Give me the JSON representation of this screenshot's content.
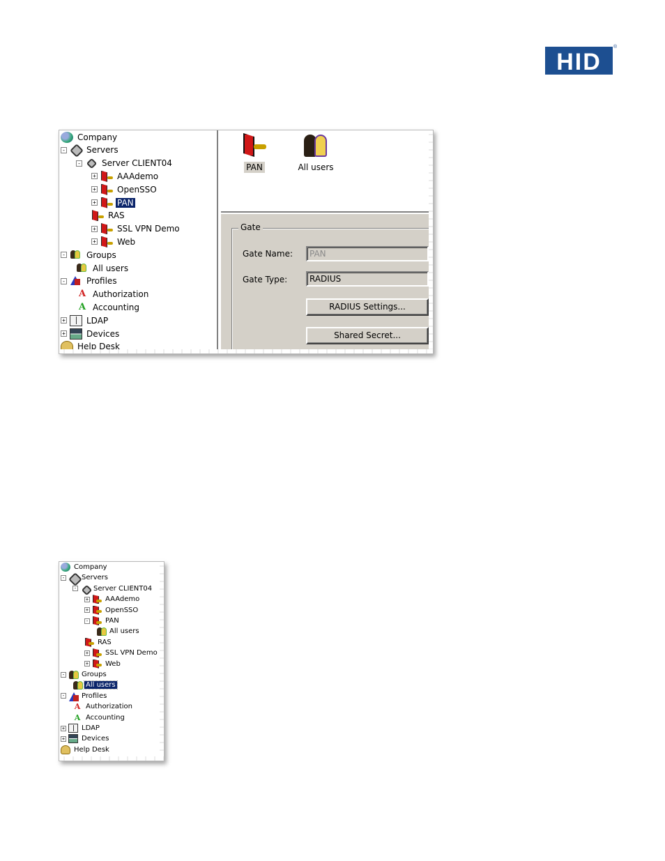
{
  "logo": {
    "text": "HID",
    "mark": "®"
  },
  "screenshot1": {
    "tree": [
      {
        "label": "Company",
        "icon": "globe-icon"
      },
      {
        "label": "Servers",
        "icon": "servers-icon",
        "expander": "-"
      },
      {
        "label": "Server CLIENT04",
        "icon": "server-icon",
        "expander": "-"
      },
      {
        "label": "AAAdemo",
        "icon": "gate-icon",
        "expander": "+"
      },
      {
        "label": "OpenSSO",
        "icon": "gate-icon",
        "expander": "+"
      },
      {
        "label": "PAN",
        "icon": "gate-icon",
        "expander": "+",
        "selected": true
      },
      {
        "label": "RAS",
        "icon": "gate-icon"
      },
      {
        "label": "SSL VPN Demo",
        "icon": "gate-icon",
        "expander": "+"
      },
      {
        "label": "Web",
        "icon": "gate-icon",
        "expander": "+"
      },
      {
        "label": "Groups",
        "icon": "users-icon",
        "expander": "-"
      },
      {
        "label": "All users",
        "icon": "users-icon"
      },
      {
        "label": "Profiles",
        "icon": "profiles-icon",
        "expander": "-"
      },
      {
        "label": "Authorization",
        "icon": "authorization-icon"
      },
      {
        "label": "Accounting",
        "icon": "accounting-icon"
      },
      {
        "label": "LDAP",
        "icon": "ldap-icon",
        "expander": "+"
      },
      {
        "label": "Devices",
        "icon": "devices-icon",
        "expander": "+"
      },
      {
        "label": "Help Desk",
        "icon": "help-desk-icon"
      }
    ],
    "list_items": [
      {
        "label": "PAN",
        "icon": "gate-icon"
      },
      {
        "label": "All users",
        "icon": "users-icon"
      }
    ],
    "gate": {
      "group_title": "Gate",
      "name_label": "Gate Name:",
      "name_value": "PAN",
      "type_label": "Gate Type:",
      "type_value": "RADIUS",
      "radius_settings_button": "RADIUS Settings...",
      "shared_secret_button": "Shared Secret..."
    }
  },
  "screenshot2": {
    "tree": [
      {
        "label": "Company",
        "icon": "globe-icon"
      },
      {
        "label": "Servers",
        "icon": "servers-icon",
        "expander": "-"
      },
      {
        "label": "Server CLIENT04",
        "icon": "server-icon",
        "expander": "-"
      },
      {
        "label": "AAAdemo",
        "icon": "gate-icon",
        "expander": "+"
      },
      {
        "label": "OpenSSO",
        "icon": "gate-icon",
        "expander": "+"
      },
      {
        "label": "PAN",
        "icon": "gate-icon",
        "expander": "-"
      },
      {
        "label": "All users",
        "icon": "users-icon"
      },
      {
        "label": "RAS",
        "icon": "gate-icon"
      },
      {
        "label": "SSL VPN Demo",
        "icon": "gate-icon",
        "expander": "+"
      },
      {
        "label": "Web",
        "icon": "gate-icon",
        "expander": "+"
      },
      {
        "label": "Groups",
        "icon": "users-icon",
        "expander": "-"
      },
      {
        "label": "All users",
        "icon": "users-icon",
        "selected": true
      },
      {
        "label": "Profiles",
        "icon": "profiles-icon",
        "expander": "-"
      },
      {
        "label": "Authorization",
        "icon": "authorization-icon"
      },
      {
        "label": "Accounting",
        "icon": "accounting-icon"
      },
      {
        "label": "LDAP",
        "icon": "ldap-icon",
        "expander": "+"
      },
      {
        "label": "Devices",
        "icon": "devices-icon",
        "expander": "+"
      },
      {
        "label": "Help Desk",
        "icon": "help-desk-icon"
      }
    ]
  },
  "colors": {
    "brand": "#1d4f91",
    "selection": "#0a246a",
    "dialog_face": "#d4d0c8"
  }
}
